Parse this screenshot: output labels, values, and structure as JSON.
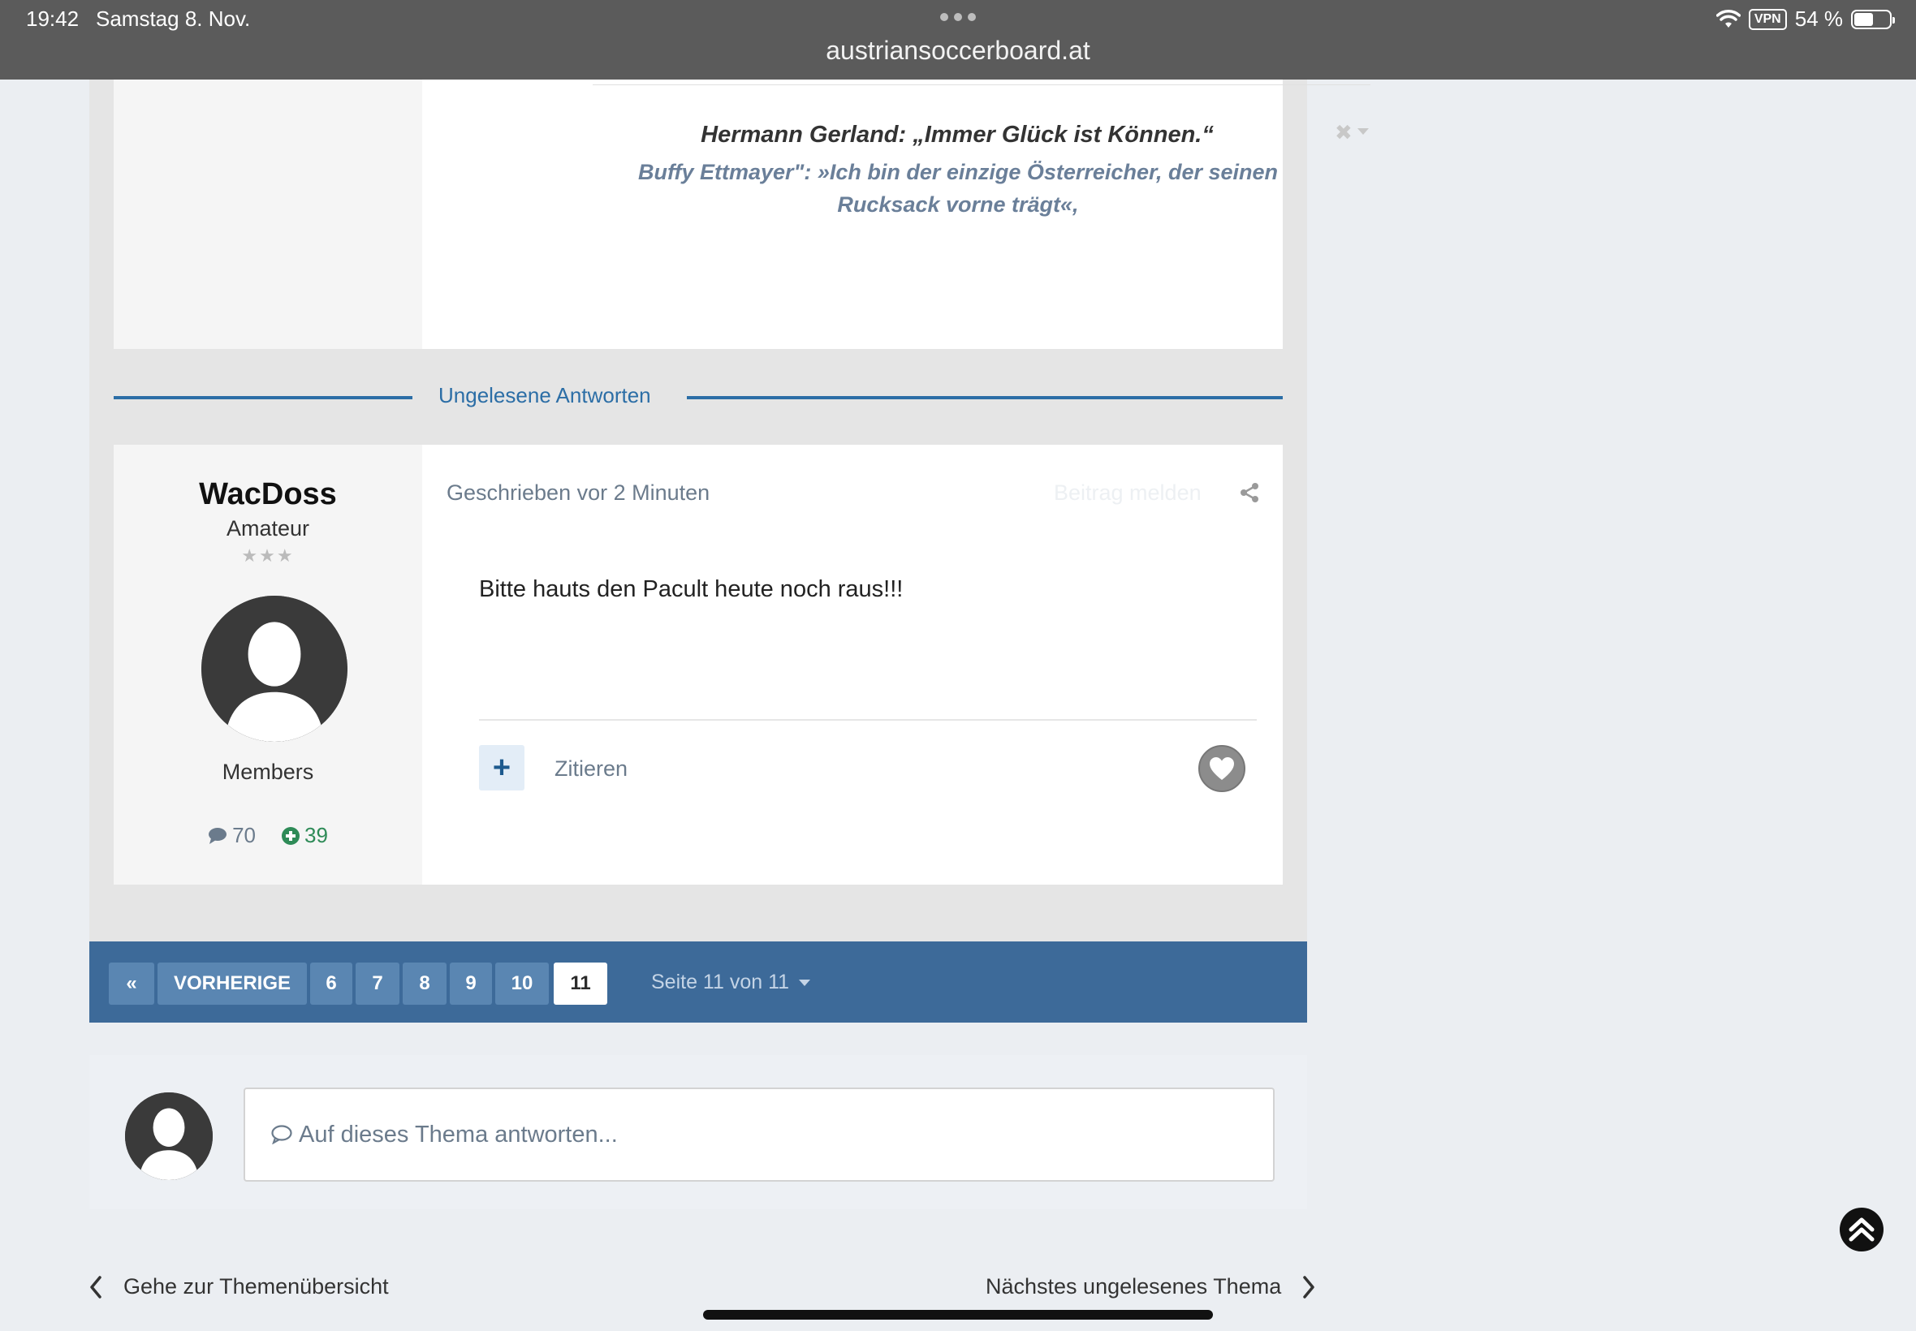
{
  "status_bar": {
    "time": "19:42",
    "date": "Samstag 8. Nov.",
    "vpn": "VPN",
    "battery": "54 %",
    "battery_level": 0.54
  },
  "browser": {
    "url": "austriansoccerboard.at"
  },
  "signature": {
    "line1": "Hermann Gerland: „Immer Glück ist Können.“",
    "line2": "Buffy Ettmayer\": »Ich bin der einzige Österreicher, der seinen Rucksack vorne trägt«,"
  },
  "unread_separator": "Ungelesene Antworten",
  "post": {
    "author_name": "WacDoss",
    "author_rank": "Amateur",
    "author_stars": "★★★",
    "author_group": "Members",
    "post_count": "70",
    "reputation": "39",
    "meta": "Geschrieben vor 2 Minuten",
    "report": "Beitrag melden",
    "body": "Bitte hauts den Pacult heute noch raus!!!",
    "multiquote": "+",
    "quote": "Zitieren"
  },
  "pagination": {
    "first": "«",
    "previous": "VORHERIGE",
    "pages": [
      "6",
      "7",
      "8",
      "9",
      "10",
      "11"
    ],
    "current": "11",
    "info": "Seite 11 von 11"
  },
  "reply": {
    "placeholder": "Auf dieses Thema antworten..."
  },
  "footer_nav": {
    "prev": "Gehe zur Themenübersicht",
    "next": "Nächstes ungelesenes Thema"
  },
  "colors": {
    "accent": "#2c6ea6",
    "pagination_bg": "#3d6a99",
    "reputation": "#2e8b57"
  },
  "icons": {
    "wifi": "wifi-icon",
    "battery": "battery-icon",
    "share": "share-icon",
    "comment": "comment-icon",
    "plus_circle": "plus-circle-icon",
    "heart": "heart-icon",
    "chevron_left": "chevron-left-icon",
    "chevron_right": "chevron-right-icon",
    "back_to_top": "chevron-up-icon"
  }
}
